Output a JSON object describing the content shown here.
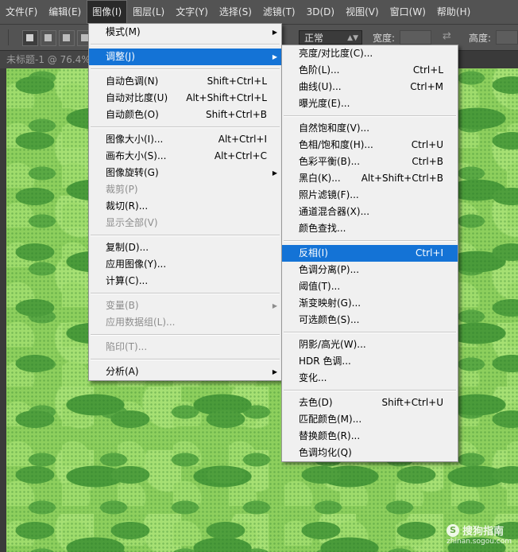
{
  "menubar": {
    "items": [
      "文件(F)",
      "编辑(E)",
      "图像(I)",
      "图层(L)",
      "文字(Y)",
      "选择(S)",
      "滤镜(T)",
      "3D(D)",
      "视图(V)",
      "窗口(W)",
      "帮助(H)"
    ],
    "active_index": 2
  },
  "options": {
    "style_value": "正常",
    "width_label": "宽度:",
    "height_label": "高度:"
  },
  "document": {
    "tab_title": "未标题-1 @ 76.4%"
  },
  "image_menu": {
    "items": [
      {
        "label": "模式(M)",
        "shortcut": "",
        "submenu": true,
        "disabled": false
      },
      {
        "sep": true
      },
      {
        "label": "调整(J)",
        "shortcut": "",
        "submenu": true,
        "disabled": false,
        "highlight": true
      },
      {
        "sep": true
      },
      {
        "label": "自动色调(N)",
        "shortcut": "Shift+Ctrl+L"
      },
      {
        "label": "自动对比度(U)",
        "shortcut": "Alt+Shift+Ctrl+L"
      },
      {
        "label": "自动颜色(O)",
        "shortcut": "Shift+Ctrl+B"
      },
      {
        "sep": true
      },
      {
        "label": "图像大小(I)...",
        "shortcut": "Alt+Ctrl+I"
      },
      {
        "label": "画布大小(S)...",
        "shortcut": "Alt+Ctrl+C"
      },
      {
        "label": "图像旋转(G)",
        "shortcut": "",
        "submenu": true
      },
      {
        "label": "裁剪(P)",
        "shortcut": "",
        "disabled": true
      },
      {
        "label": "裁切(R)...",
        "shortcut": ""
      },
      {
        "label": "显示全部(V)",
        "shortcut": "",
        "disabled": true
      },
      {
        "sep": true
      },
      {
        "label": "复制(D)...",
        "shortcut": ""
      },
      {
        "label": "应用图像(Y)...",
        "shortcut": ""
      },
      {
        "label": "计算(C)...",
        "shortcut": ""
      },
      {
        "sep": true
      },
      {
        "label": "变量(B)",
        "shortcut": "",
        "submenu": true,
        "disabled": true
      },
      {
        "label": "应用数据组(L)...",
        "shortcut": "",
        "disabled": true
      },
      {
        "sep": true
      },
      {
        "label": "陷印(T)...",
        "shortcut": "",
        "disabled": true
      },
      {
        "sep": true
      },
      {
        "label": "分析(A)",
        "shortcut": "",
        "submenu": true
      }
    ]
  },
  "adjust_menu": {
    "items": [
      {
        "label": "亮度/对比度(C)...",
        "shortcut": ""
      },
      {
        "label": "色阶(L)...",
        "shortcut": "Ctrl+L"
      },
      {
        "label": "曲线(U)...",
        "shortcut": "Ctrl+M"
      },
      {
        "label": "曝光度(E)...",
        "shortcut": ""
      },
      {
        "sep": true
      },
      {
        "label": "自然饱和度(V)...",
        "shortcut": ""
      },
      {
        "label": "色相/饱和度(H)...",
        "shortcut": "Ctrl+U"
      },
      {
        "label": "色彩平衡(B)...",
        "shortcut": "Ctrl+B"
      },
      {
        "label": "黑白(K)...",
        "shortcut": "Alt+Shift+Ctrl+B"
      },
      {
        "label": "照片滤镜(F)...",
        "shortcut": ""
      },
      {
        "label": "通道混合器(X)...",
        "shortcut": ""
      },
      {
        "label": "颜色查找...",
        "shortcut": ""
      },
      {
        "sep": true
      },
      {
        "label": "反相(I)",
        "shortcut": "Ctrl+I",
        "highlight": true
      },
      {
        "label": "色调分离(P)...",
        "shortcut": ""
      },
      {
        "label": "阈值(T)...",
        "shortcut": ""
      },
      {
        "label": "渐变映射(G)...",
        "shortcut": ""
      },
      {
        "label": "可选颜色(S)...",
        "shortcut": ""
      },
      {
        "sep": true
      },
      {
        "label": "阴影/高光(W)...",
        "shortcut": ""
      },
      {
        "label": "HDR 色调...",
        "shortcut": ""
      },
      {
        "label": "变化...",
        "shortcut": ""
      },
      {
        "sep": true
      },
      {
        "label": "去色(D)",
        "shortcut": "Shift+Ctrl+U"
      },
      {
        "label": "匹配颜色(M)...",
        "shortcut": ""
      },
      {
        "label": "替换颜色(R)...",
        "shortcut": ""
      },
      {
        "label": "色调均化(Q)",
        "shortcut": ""
      }
    ]
  },
  "watermark": {
    "main": "搜狗指南",
    "sub": "zhinan.sogou.com",
    "logo_glyph": "S"
  },
  "colors": {
    "highlight": "#1473d6",
    "canvas_green": "#8dcf5d"
  }
}
